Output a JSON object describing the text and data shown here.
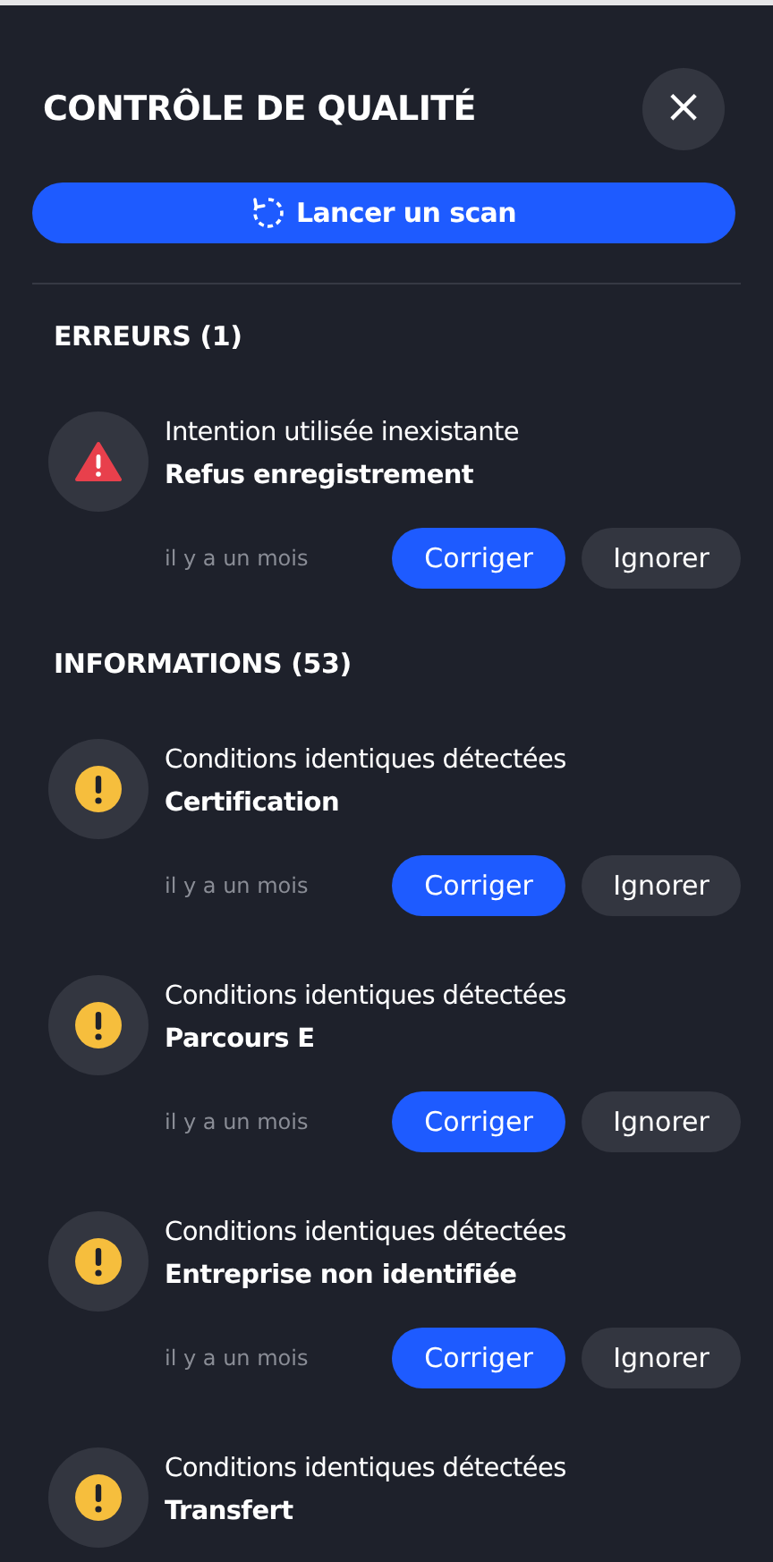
{
  "panel": {
    "title": "CONTRÔLE DE QUALITÉ",
    "close_label": "×",
    "scan_button": "Lancer un scan"
  },
  "sections": [
    {
      "heading": "ERREURS (1)",
      "items": [
        {
          "kind": "error",
          "title": "Intention utilisée inexistante",
          "subtitle": "Refus enregistrement",
          "time": "il y a un mois",
          "actions": [
            "Corriger",
            "Ignorer"
          ]
        }
      ]
    },
    {
      "heading": "INFORMATIONS (53)",
      "items": [
        {
          "kind": "info",
          "title": "Conditions identiques détectées",
          "subtitle": "Certification",
          "time": "il y a un mois",
          "actions": [
            "Corriger",
            "Ignorer"
          ]
        },
        {
          "kind": "info",
          "title": "Conditions identiques détectées",
          "subtitle": "Parcours E",
          "time": "il y a un mois",
          "actions": [
            "Corriger",
            "Ignorer"
          ]
        },
        {
          "kind": "info",
          "title": "Conditions identiques détectées",
          "subtitle": "Entreprise non identifiée",
          "time": "il y a un mois",
          "actions": [
            "Corriger",
            "Ignorer"
          ]
        },
        {
          "kind": "info",
          "title": "Conditions identiques détectées",
          "subtitle": "Transfert"
        }
      ]
    }
  ]
}
